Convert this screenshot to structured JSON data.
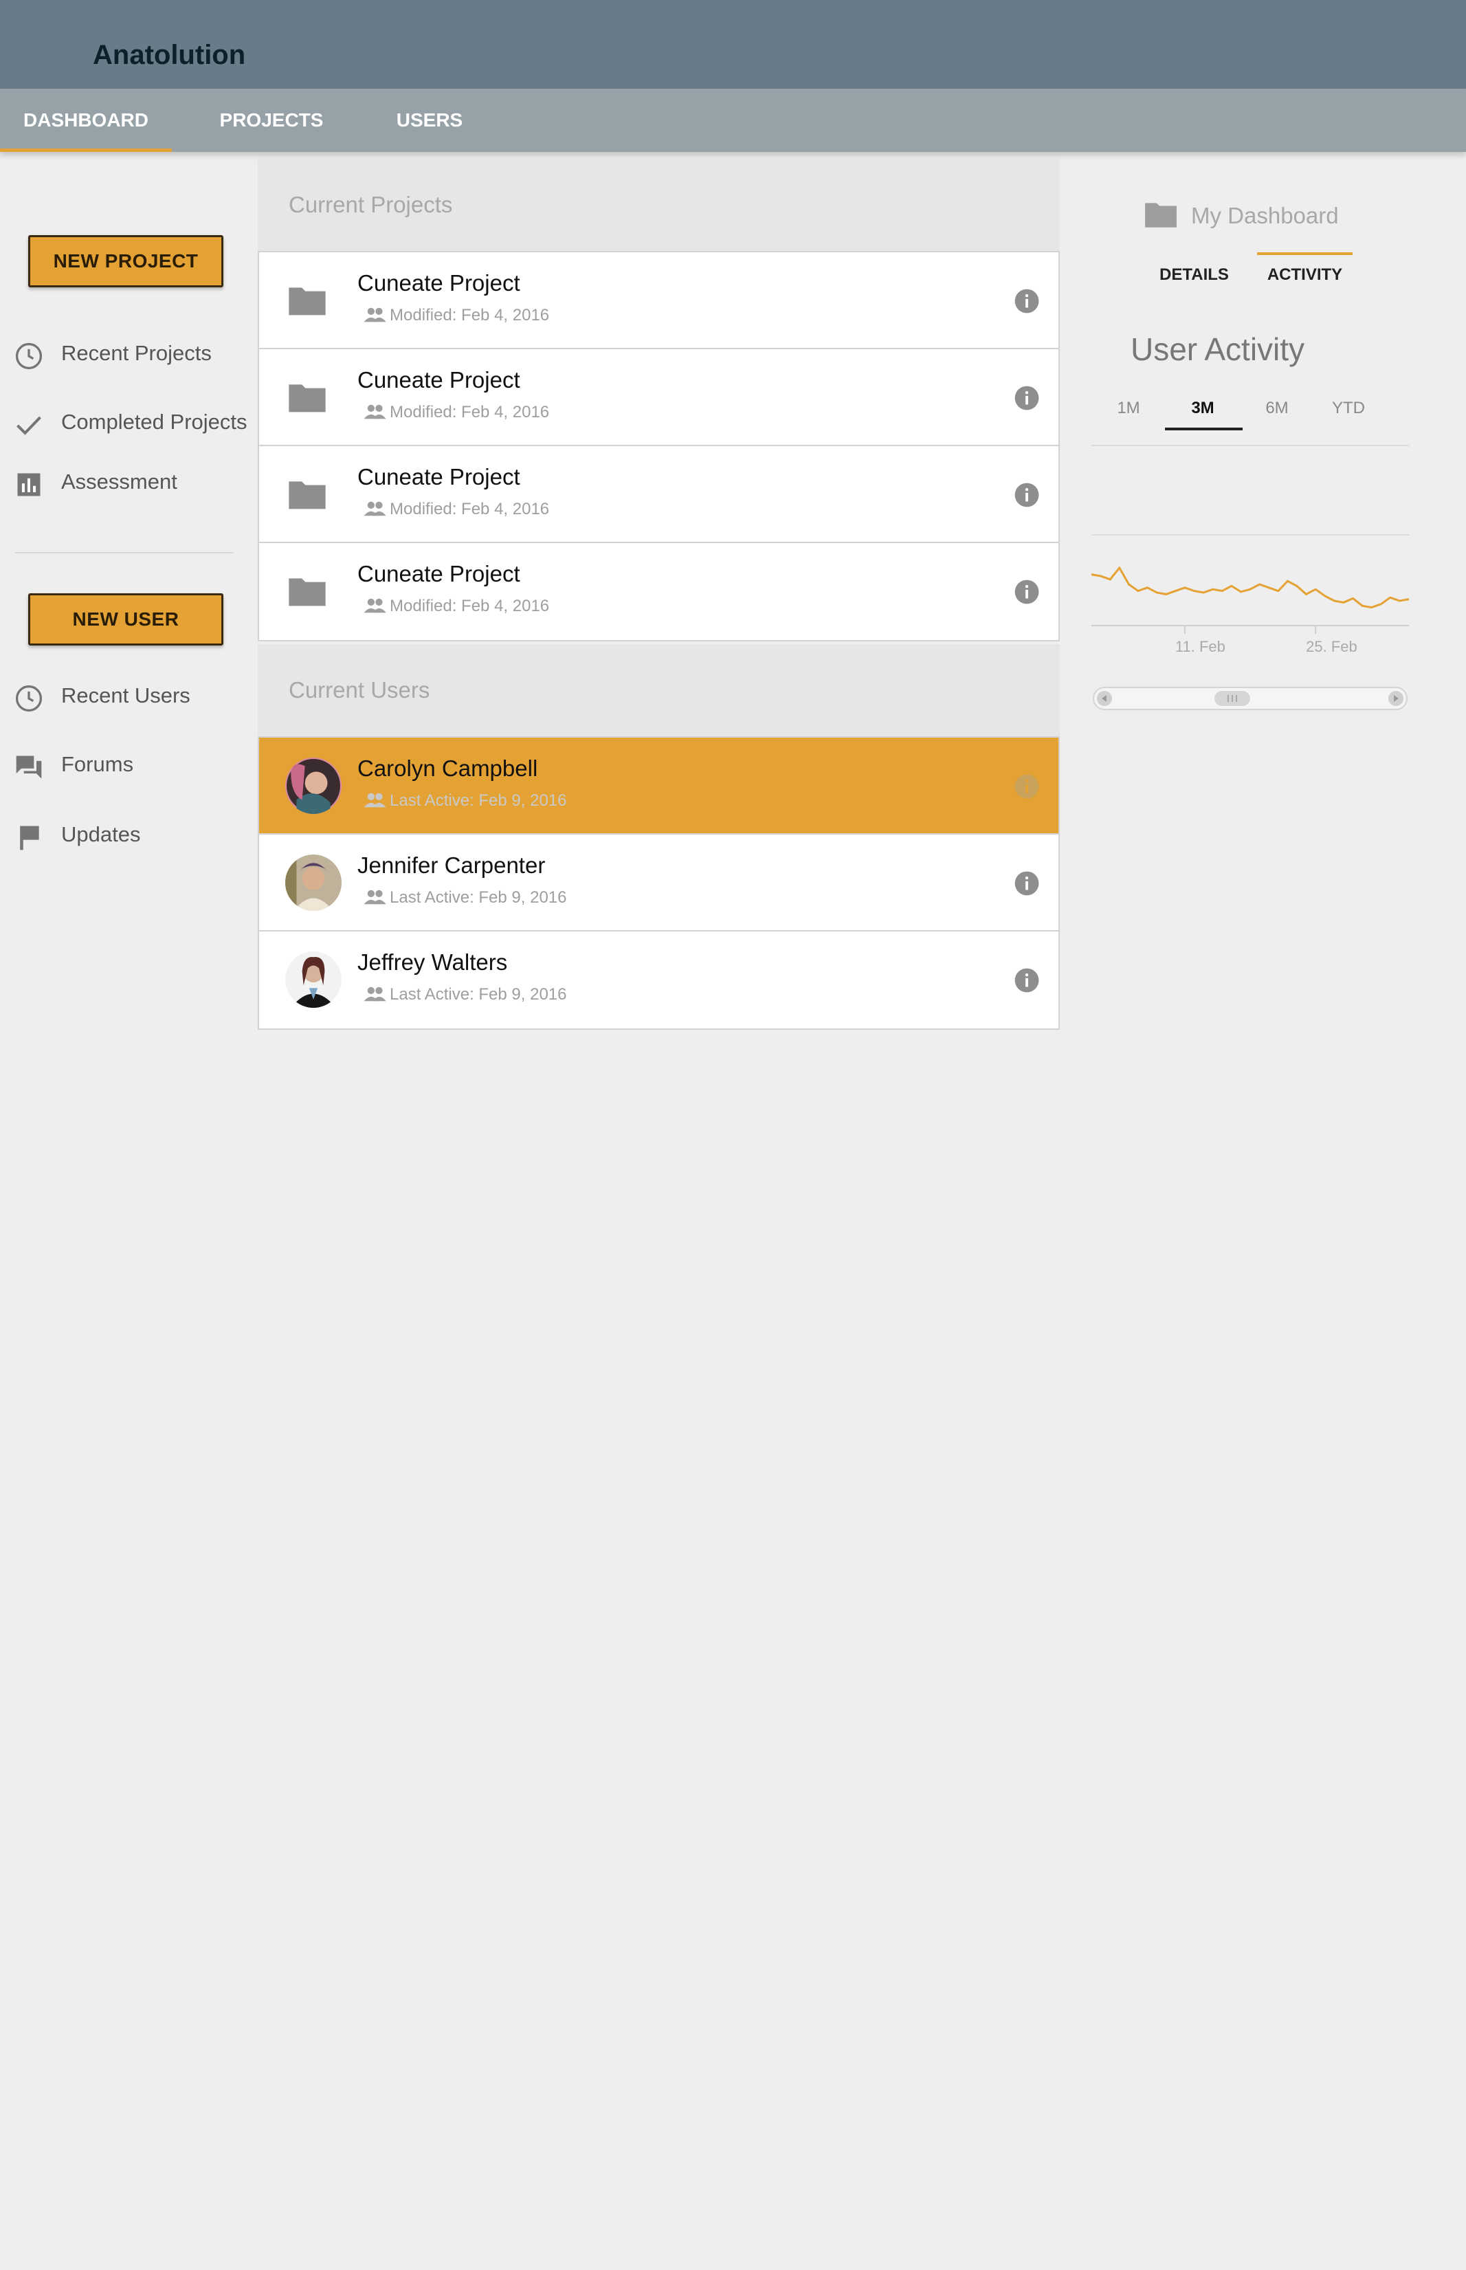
{
  "app": {
    "title": "Anatolution"
  },
  "nav": {
    "tabs": [
      "DASHBOARD",
      "PROJECTS",
      "USERS"
    ],
    "active": "DASHBOARD"
  },
  "sidebar": {
    "new_project_label": "NEW PROJECT",
    "project_items": [
      {
        "label": "Recent Projects",
        "icon": "clock-icon"
      },
      {
        "label": "Completed Projects",
        "icon": "check-icon"
      },
      {
        "label": "Assessment",
        "icon": "bar-chart-icon"
      }
    ],
    "new_user_label": "NEW USER",
    "user_items": [
      {
        "label": "Recent Users",
        "icon": "clock-icon"
      },
      {
        "label": "Forums",
        "icon": "forum-icon"
      },
      {
        "label": "Updates",
        "icon": "flag-icon"
      }
    ]
  },
  "projects": {
    "header": "Current Projects",
    "items": [
      {
        "title": "Cuneate Project",
        "meta": "Modified: Feb 4, 2016"
      },
      {
        "title": "Cuneate Project",
        "meta": "Modified: Feb 4, 2016"
      },
      {
        "title": "Cuneate Project",
        "meta": "Modified: Feb 4, 2016"
      },
      {
        "title": "Cuneate Project",
        "meta": "Modified: Feb 4, 2016"
      }
    ]
  },
  "users": {
    "header": "Current Users",
    "items": [
      {
        "name": "Carolyn Campbell",
        "meta": "Last Active: Feb 9, 2016",
        "selected": true
      },
      {
        "name": "Jennifer Carpenter",
        "meta": "Last Active: Feb 9, 2016",
        "selected": false
      },
      {
        "name": "Jeffrey Walters",
        "meta": "Last Active: Feb 9, 2016",
        "selected": false
      }
    ]
  },
  "dashboard": {
    "title": "My Dashboard",
    "tabs": [
      "DETAILS",
      "ACTIVITY"
    ],
    "active_tab": "ACTIVITY",
    "activity_title": "User Activity",
    "ranges": [
      "1M",
      "3M",
      "6M",
      "YTD"
    ],
    "active_range": "3M"
  },
  "colors": {
    "accent": "#e5a234",
    "titlebar": "#687b89",
    "tabbar": "#96a1a8",
    "background": "#eeeeee"
  },
  "chart_data": {
    "type": "line",
    "title": "User Activity",
    "x_tick_labels": [
      "11. Feb",
      "25. Feb"
    ],
    "x": [
      "Feb 1",
      "Feb 2",
      "Feb 3",
      "Feb 4",
      "Feb 5",
      "Feb 6",
      "Feb 7",
      "Feb 8",
      "Feb 9",
      "Feb 10",
      "Feb 11",
      "Feb 12",
      "Feb 13",
      "Feb 14",
      "Feb 15",
      "Feb 16",
      "Feb 17",
      "Feb 18",
      "Feb 19",
      "Feb 20",
      "Feb 21",
      "Feb 22",
      "Feb 23",
      "Feb 24",
      "Feb 25",
      "Feb 26",
      "Feb 27",
      "Feb 28",
      "Feb 29",
      "Mar 1",
      "Mar 2",
      "Mar 3",
      "Mar 4",
      "Mar 5",
      "Mar 6"
    ],
    "series": [
      {
        "values": [
          62,
          60,
          56,
          70,
          50,
          42,
          46,
          40,
          38,
          42,
          46,
          42,
          40,
          44,
          42,
          48,
          41,
          44,
          50,
          46,
          42,
          54,
          48,
          38,
          44,
          36,
          30,
          28,
          33,
          24,
          22,
          26,
          34,
          30,
          32
        ]
      }
    ],
    "ylim": [
      0,
      100
    ],
    "grid": false,
    "legend": "none",
    "color": "#e5a234"
  }
}
